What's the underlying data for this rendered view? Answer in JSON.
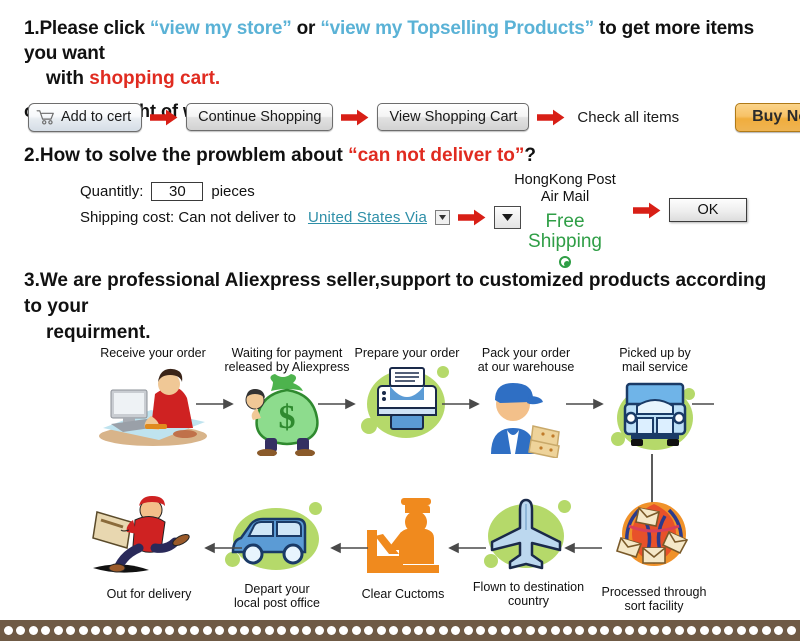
{
  "section1": {
    "line1_prefix": "1.Please click ",
    "link1": "“view my store”",
    "between": " or ",
    "link2": "“view my Topselling Products”",
    "line1_suffix": " to get more items you want",
    "line2_prefix": "with ",
    "line2_highlight": "shopping cart.",
    "line3": "on the top right of webpage:"
  },
  "buttons": {
    "add_to_cart": "Add to cert",
    "cart_icon": "shopping-cart-icon",
    "continue_shopping": "Continue Shopping",
    "view_shopping_cart": "View Shopping Cart",
    "check_all_items": "Check all items",
    "buy_now": "Buy Now"
  },
  "section2": {
    "title_prefix": "2.How to solve the prowblem about ",
    "title_highlight": "“can not deliver to”",
    "title_suffix": "?",
    "quantity_label": "Quantitly:",
    "quantity_value": "30",
    "pieces_label": "pieces",
    "shipping_label": "Shipping cost: Can not deliver to",
    "destination_value": "United States Via",
    "mini_dropdown_icon": "chevron-down-icon",
    "big_dropdown_icon": "chevron-down-icon",
    "carrier_line1": "HongKong Post",
    "carrier_line2": "Air Mail",
    "free_shipping_line1": "Free",
    "free_shipping_line2": "Shipping",
    "ok_button": "OK"
  },
  "section3": {
    "line1": "3.We are professional Aliexpress seller,support to customized products according to your",
    "line2": "requirment."
  },
  "flow": {
    "top_row": [
      {
        "caption": "Receive your order",
        "icon": "person-at-computer-icon"
      },
      {
        "caption": "Waiting for payment\nreleased by Aliexpress",
        "icon": "money-bag-icon"
      },
      {
        "caption": "Prepare your order",
        "icon": "printer-icon"
      },
      {
        "caption": "Pack your order\nat our warehouse",
        "icon": "worker-with-boxes-icon"
      },
      {
        "caption": "Picked up by\nmail service",
        "icon": "mail-truck-icon"
      }
    ],
    "bottom_row": [
      {
        "caption": "Out for delivery",
        "icon": "running-courier-icon"
      },
      {
        "caption": "Depart your\nlocal post office",
        "icon": "delivery-van-icon"
      },
      {
        "caption": "Clear Cuctoms",
        "icon": "customs-officer-icon"
      },
      {
        "caption": "Flown to destination\ncountry",
        "icon": "airplane-icon"
      },
      {
        "caption": "Processed through\nsort facility",
        "icon": "mail-sorting-globe-icon"
      }
    ]
  },
  "colors": {
    "link_blue": "#5ab2d6",
    "highlight_red": "#e02b20",
    "free_green": "#2f9e46",
    "dest_teal": "#2e8fa8",
    "arrow_red": "#d81f16",
    "buy_now_orange": "#f0ad3d",
    "blob_green": "#b5d96a",
    "bottom_bar_brown": "#6f5a45"
  }
}
